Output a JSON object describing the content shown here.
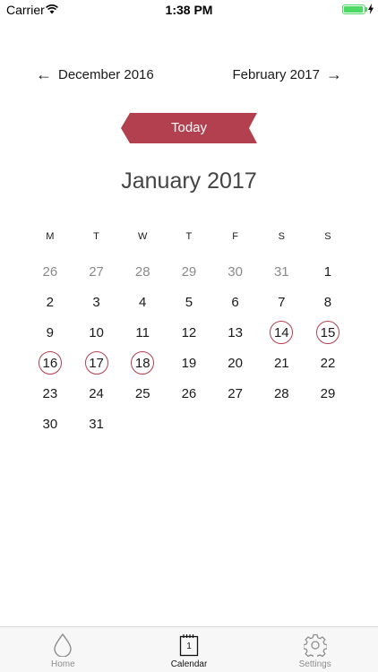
{
  "status_bar": {
    "carrier": "Carrier",
    "time": "1:38 PM",
    "battery_level": 0.95
  },
  "nav": {
    "prev_month": "December 2016",
    "next_month": "February 2017"
  },
  "today_button": "Today",
  "month_title": "January 2017",
  "weekdays": [
    "M",
    "T",
    "W",
    "T",
    "F",
    "S",
    "S"
  ],
  "weeks": [
    [
      {
        "d": "26",
        "m": true
      },
      {
        "d": "27",
        "m": true
      },
      {
        "d": "28",
        "m": true
      },
      {
        "d": "29",
        "m": true
      },
      {
        "d": "30",
        "m": true
      },
      {
        "d": "31",
        "m": true
      },
      {
        "d": "1"
      }
    ],
    [
      {
        "d": "2"
      },
      {
        "d": "3"
      },
      {
        "d": "4"
      },
      {
        "d": "5"
      },
      {
        "d": "6"
      },
      {
        "d": "7"
      },
      {
        "d": "8"
      }
    ],
    [
      {
        "d": "9"
      },
      {
        "d": "10"
      },
      {
        "d": "11"
      },
      {
        "d": "12"
      },
      {
        "d": "13"
      },
      {
        "d": "14",
        "c": true
      },
      {
        "d": "15",
        "c": true
      }
    ],
    [
      {
        "d": "16",
        "c": true
      },
      {
        "d": "17",
        "c": true
      },
      {
        "d": "18",
        "c": true
      },
      {
        "d": "19"
      },
      {
        "d": "20"
      },
      {
        "d": "21"
      },
      {
        "d": "22"
      }
    ],
    [
      {
        "d": "23"
      },
      {
        "d": "24"
      },
      {
        "d": "25"
      },
      {
        "d": "26"
      },
      {
        "d": "27"
      },
      {
        "d": "28"
      },
      {
        "d": "29"
      }
    ],
    [
      {
        "d": "30"
      },
      {
        "d": "31"
      }
    ]
  ],
  "tabs": [
    {
      "label": "Home",
      "icon": "drop-icon"
    },
    {
      "label": "Calendar",
      "icon": "calendar-icon",
      "icon_text": "1"
    },
    {
      "label": "Settings",
      "icon": "gear-icon"
    }
  ],
  "colors": {
    "accent": "#b3404f",
    "muted_day": "#8a8a8a",
    "battery": "#4cd964"
  }
}
